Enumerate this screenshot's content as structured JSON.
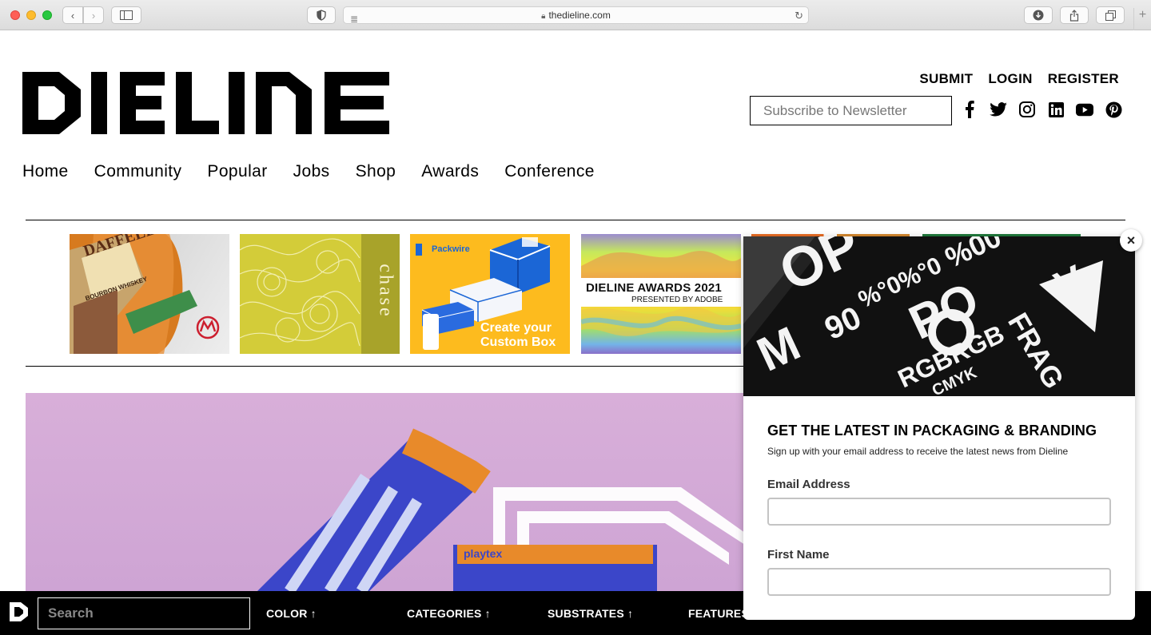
{
  "browser": {
    "url": "thedieline.com"
  },
  "header": {
    "logo_text": "DIELINE",
    "links": [
      "SUBMIT",
      "LOGIN",
      "REGISTER"
    ],
    "newsletter_placeholder": "Subscribe to Newsletter",
    "social_icons": [
      "facebook-icon",
      "twitter-icon",
      "instagram-icon",
      "linkedin-icon",
      "youtube-icon",
      "pinterest-icon"
    ]
  },
  "nav": [
    "Home",
    "Community",
    "Popular",
    "Jobs",
    "Shop",
    "Awards",
    "Conference"
  ],
  "ads": {
    "whiskey_label": "BOURBON WHISKEY",
    "chase_text": "chase",
    "packwire_brand": "Packwire",
    "packwire_cta_1": "Create your",
    "packwire_cta_2": "Custom Box",
    "awards_title": "DIELINE AWARDS 2021",
    "awards_sub": "PRESENTED BY ADOBE"
  },
  "bottom_bar": {
    "search_placeholder": "Search",
    "categories": [
      "COLOR ↑",
      "CATEGORIES ↑",
      "SUBSTRATES ↑",
      "FEATURES"
    ]
  },
  "popup": {
    "title": "GET THE LATEST IN PACKAGING & BRANDING",
    "subtitle": "Sign up with your email address to receive the latest news from Dieline",
    "email_label": "Email Address",
    "first_name_label": "First Name",
    "close_symbol": "×"
  },
  "colors": {
    "hero_bg": "#d3a9d6",
    "packwire_bg": "#fdbb1e",
    "bottom_bar": "#000000"
  }
}
